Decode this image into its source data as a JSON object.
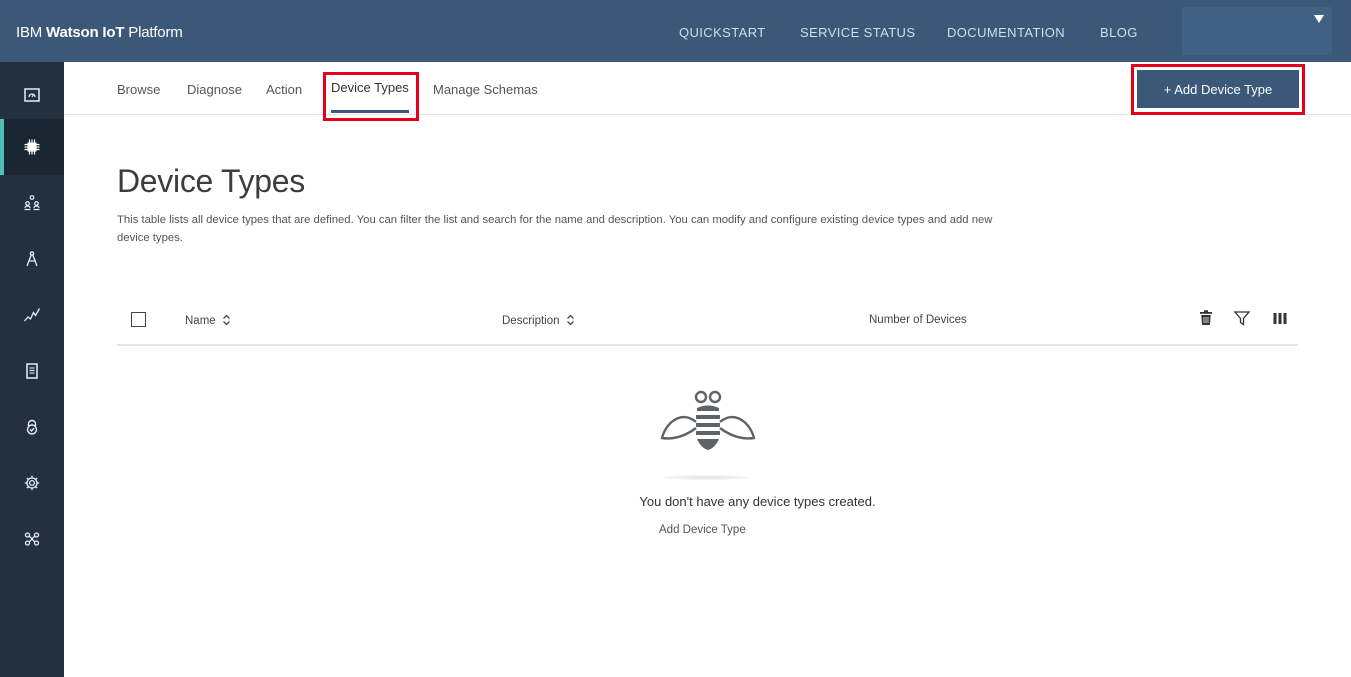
{
  "header": {
    "brand_prefix": "IBM ",
    "brand_bold": "Watson IoT",
    "brand_suffix": " Platform",
    "nav": [
      "QUICKSTART",
      "SERVICE STATUS",
      "DOCUMENTATION",
      "BLOG"
    ]
  },
  "sidebar": {
    "items": [
      {
        "icon": "dashboard-icon"
      },
      {
        "icon": "chip-icon",
        "active": true
      },
      {
        "icon": "members-icon"
      },
      {
        "icon": "compass-icon"
      },
      {
        "icon": "usage-chart-icon"
      },
      {
        "icon": "document-icon"
      },
      {
        "icon": "security-lock-icon"
      },
      {
        "icon": "settings-gear-icon"
      },
      {
        "icon": "extensions-icon"
      }
    ]
  },
  "subnav": {
    "tabs": [
      "Browse",
      "Diagnose",
      "Action",
      "Device Types",
      "Manage Schemas"
    ],
    "active_tab": "Device Types",
    "add_button": "+ Add Device Type"
  },
  "main": {
    "title": "Device Types",
    "description": "This table lists all device types that are defined. You can filter the list and search for the name and description. You can modify and configure existing device types and add new device types.",
    "table": {
      "columns": [
        "Name",
        "Description",
        "Number of Devices"
      ]
    },
    "empty": {
      "message": "You don't have any device types created.",
      "link": "Add Device Type"
    }
  },
  "colors": {
    "header_bg": "#3b5878",
    "sidebar_bg": "#223040",
    "accent": "#4dbfb3",
    "highlight": "#e3001b"
  }
}
